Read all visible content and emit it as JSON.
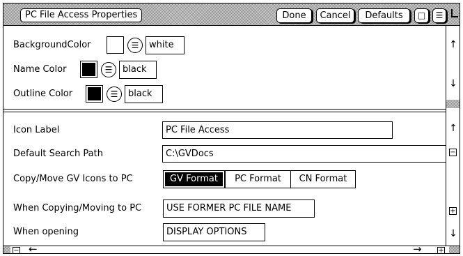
{
  "window": {
    "title": "PC File Access Properties",
    "buttons": {
      "done": "Done",
      "cancel": "Cancel",
      "defaults": "Defaults"
    }
  },
  "icons": {
    "window_square": "□",
    "window_menu": "☰",
    "menu": "☰",
    "arrow_up": "↑",
    "arrow_down": "↓",
    "arrow_left": "←",
    "arrow_right": "→",
    "plus": "+",
    "minus": "−"
  },
  "colors": {
    "background_color": {
      "label": "BackgroundColor",
      "value": "white",
      "swatch": "#ffffff"
    },
    "name_color": {
      "label": "Name Color",
      "value": "black",
      "swatch": "#000000"
    },
    "outline_color": {
      "label": "Outline Color",
      "value": "black",
      "swatch": "#000000"
    }
  },
  "properties": {
    "icon_label": {
      "label": "Icon Label",
      "value": "PC File Access"
    },
    "default_search_path": {
      "label": "Default Search Path",
      "value": "C:\\GVDocs"
    },
    "copy_move": {
      "label": "Copy/Move GV Icons to PC",
      "options": [
        "GV Format",
        "PC Format",
        "CN Format"
      ],
      "selected": "GV Format"
    },
    "when_copying": {
      "label": "When Copying/Moving to PC",
      "value": "USE FORMER PC FILE NAME"
    },
    "when_opening": {
      "label": "When opening",
      "value": "DISPLAY OPTIONS"
    }
  }
}
